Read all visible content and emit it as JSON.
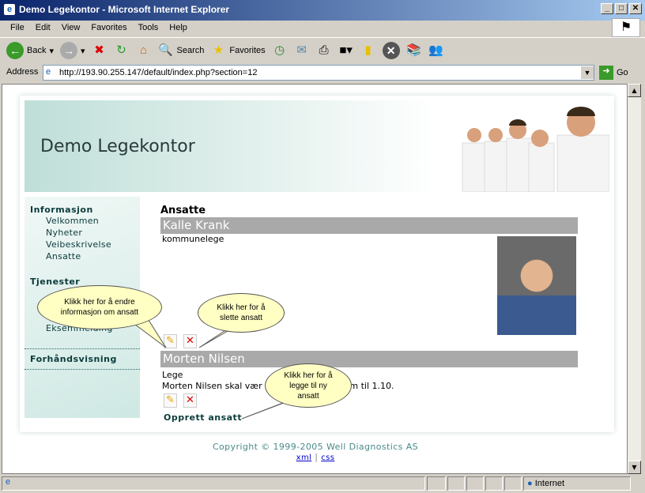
{
  "window": {
    "title": "Demo Legekontor - Microsoft Internet Explorer",
    "controls": [
      "_",
      "□",
      "✕"
    ]
  },
  "menu": [
    "File",
    "Edit",
    "View",
    "Favorites",
    "Tools",
    "Help"
  ],
  "toolbar": {
    "back": "Back",
    "search": "Search",
    "favorites": "Favorites"
  },
  "address": {
    "label": "Address",
    "url": "http://193.90.255.147/default/index.php?section=12",
    "go": "Go"
  },
  "site": {
    "title": "Demo Legekontor"
  },
  "sidebar": {
    "sections": [
      {
        "title": "Informasjon",
        "items": [
          "Velkommen",
          "Nyheter",
          "Veibeskrivelse",
          "Ansatte"
        ]
      },
      {
        "title": "Tjenester",
        "items": [
          "Eksemmelding"
        ]
      },
      {
        "title": "Forhåndsvisning",
        "items": []
      }
    ]
  },
  "main": {
    "heading": "Ansatte",
    "employees": [
      {
        "name": "Kalle Krank",
        "role": "kommunelege"
      },
      {
        "name": "Morten Nilsen",
        "role": "Lege",
        "note_start": "Morten Nilsen skal vær",
        "note_end": "em til 1.10."
      }
    ],
    "create": "Opprett ansatt"
  },
  "callouts": {
    "edit": "Klikk her for å endre informasjon om ansatt",
    "delete": "Klikk her for å slette ansatt",
    "create": "Klikk her for å legge til ny ansatt"
  },
  "footer": {
    "copyright": "Copyright © 1999-2005 Well Diagnostics AS",
    "xml": "xml",
    "css": "css"
  },
  "status": {
    "zone": "Internet"
  }
}
